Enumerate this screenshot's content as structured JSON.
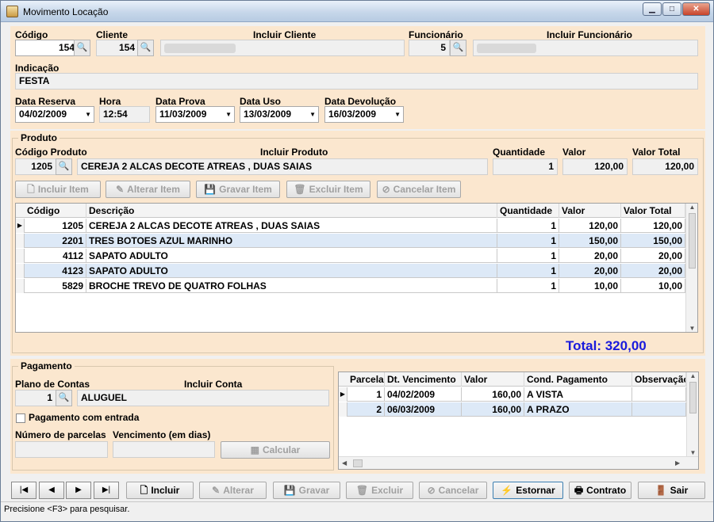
{
  "window": {
    "title": "Movimento Locação"
  },
  "header": {
    "codigo_label": "Código",
    "codigo_value": "154",
    "cliente_label": "Cliente",
    "cliente_value": "154",
    "incluir_cliente_label": "Incluir Cliente",
    "funcionario_label": "Funcionário",
    "funcionario_value": "5",
    "incluir_funcionario_label": "Incluir Funcionário",
    "indicacao_label": "Indicação",
    "indicacao_value": "FESTA",
    "data_reserva_label": "Data Reserva",
    "data_reserva_value": "04/02/2009",
    "hora_label": "Hora",
    "hora_value": "12:54",
    "data_prova_label": "Data Prova",
    "data_prova_value": "11/03/2009",
    "data_uso_label": "Data Uso",
    "data_uso_value": "13/03/2009",
    "data_devolucao_label": "Data Devolução",
    "data_devolucao_value": "16/03/2009"
  },
  "produto": {
    "legend": "Produto",
    "codigo_produto_label": "Código Produto",
    "codigo_produto_value": "1205",
    "incluir_produto_label": "Incluir Produto",
    "descricao_value": "CEREJA 2 ALCAS DECOTE ATREAS , DUAS SAIAS",
    "quantidade_label": "Quantidade",
    "quantidade_value": "1",
    "valor_label": "Valor",
    "valor_value": "120,00",
    "valor_total_label": "Valor Total",
    "valor_total_value": "120,00",
    "buttons": {
      "incluir_item": "Incluir Item",
      "alterar_item": "Alterar Item",
      "gravar_item": "Gravar Item",
      "excluir_item": "Excluir Item",
      "cancelar_item": "Cancelar Item"
    },
    "grid": {
      "headers": [
        "Código",
        "Descrição",
        "Quantidade",
        "Valor",
        "Valor Total"
      ],
      "rows": [
        [
          "1205",
          "CEREJA 2 ALCAS DECOTE ATREAS , DUAS SAIAS",
          "1",
          "120,00",
          "120,00"
        ],
        [
          "2201",
          "TRES BOTOES AZUL MARINHO",
          "1",
          "150,00",
          "150,00"
        ],
        [
          "4112",
          "SAPATO ADULTO",
          "1",
          "20,00",
          "20,00"
        ],
        [
          "4123",
          "SAPATO ADULTO",
          "1",
          "20,00",
          "20,00"
        ],
        [
          "5829",
          "BROCHE TREVO DE QUATRO FOLHAS",
          "1",
          "10,00",
          "10,00"
        ]
      ]
    },
    "total": "Total: 320,00",
    "total_color": "#1a1adc"
  },
  "pagamento": {
    "legend": "Pagamento",
    "plano_label": "Plano de Contas",
    "plano_codigo": "1",
    "incluir_conta_label": "Incluir Conta",
    "conta_value": "ALUGUEL",
    "checkbox_label": "Pagamento com entrada",
    "num_parcelas_label": "Número de parcelas",
    "vencimento_label": "Vencimento (em dias)",
    "calcular_label": "Calcular",
    "grid": {
      "headers": [
        "Parcela",
        "Dt. Vencimento",
        "Valor",
        "Cond. Pagamento",
        "Observação"
      ],
      "rows": [
        [
          "1",
          "04/02/2009",
          "160,00",
          "A VISTA",
          ""
        ],
        [
          "2",
          "06/03/2009",
          "160,00",
          "A PRAZO",
          ""
        ]
      ]
    }
  },
  "toolbar": {
    "incluir": "Incluir",
    "alterar": "Alterar",
    "gravar": "Gravar",
    "excluir": "Excluir",
    "cancelar": "Cancelar",
    "estornar": "Estornar",
    "contrato": "Contrato",
    "sair": "Sair"
  },
  "statusbar": {
    "text": "Precisione <F3> para pesquisar."
  }
}
